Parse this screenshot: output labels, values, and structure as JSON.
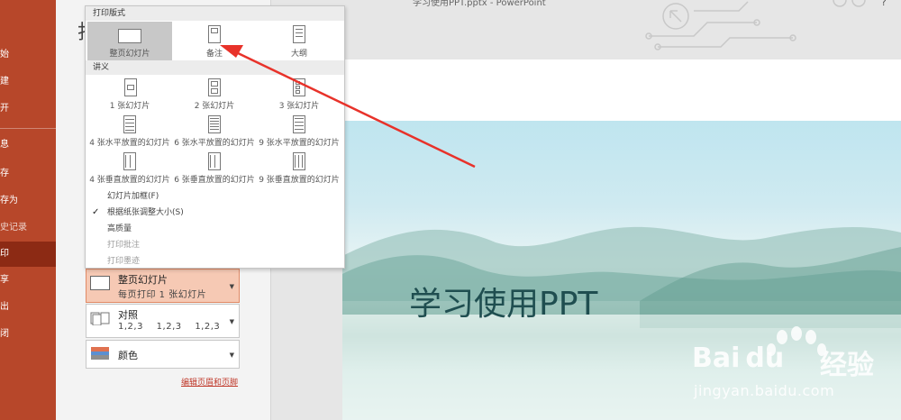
{
  "window": {
    "title": "学习使用PPT.pptx - PowerPoint"
  },
  "nav": {
    "items": [
      {
        "label": "始"
      },
      {
        "label": "建"
      },
      {
        "label": "开"
      },
      {
        "label": "息"
      },
      {
        "label": "存"
      },
      {
        "label": "存为"
      },
      {
        "label": "史记录"
      },
      {
        "label": "印",
        "active": true
      },
      {
        "label": "享"
      },
      {
        "label": "出"
      },
      {
        "label": "闭"
      }
    ]
  },
  "page": {
    "title_glyph": "打"
  },
  "popup": {
    "section_layout": "打印版式",
    "layout_options": [
      {
        "label": "整页幻灯片",
        "selected": true
      },
      {
        "label": "备注"
      },
      {
        "label": "大纲"
      }
    ],
    "section_handouts": "讲义",
    "handout_options": [
      {
        "label": "1 张幻灯片"
      },
      {
        "label": "2 张幻灯片"
      },
      {
        "label": "3 张幻灯片"
      },
      {
        "label": "4 张水平放置的幻灯片"
      },
      {
        "label": "6 张水平放置的幻灯片"
      },
      {
        "label": "9 张水平放置的幻灯片"
      },
      {
        "label": "4 张垂直放置的幻灯片"
      },
      {
        "label": "6 张垂直放置的幻灯片"
      },
      {
        "label": "9 张垂直放置的幻灯片"
      }
    ],
    "checks": [
      {
        "label": "幻灯片加框(F)",
        "checked": false,
        "enabled": true
      },
      {
        "label": "根据纸张调整大小(S)",
        "checked": true,
        "enabled": true
      },
      {
        "label": "高质量",
        "checked": false,
        "enabled": true
      },
      {
        "label": "打印批注",
        "checked": false,
        "enabled": false
      },
      {
        "label": "打印墨迹",
        "checked": false,
        "enabled": false
      }
    ],
    "checkmark": "✓"
  },
  "settings": {
    "layout_dd": {
      "title": "整页幻灯片",
      "subtitle": "每页打印 1 张幻灯片"
    },
    "collate_dd": {
      "title": "对照",
      "subtitle": "1,2,3    1,2,3    1,2,3"
    },
    "color_dd": {
      "title": "颜色"
    },
    "edit_link": "编辑页眉和页脚"
  },
  "preview": {
    "slide_title": "学习使用PPT"
  },
  "watermark": {
    "brand": "Bai",
    "paw": "du",
    "name": "经验",
    "url": "jingyan.baidu.com"
  },
  "help": "?",
  "colors": {
    "accent": "#b7472a",
    "nav_active": "#8c2a14",
    "arrow": "#e8322a",
    "selected_bg": "#f6c9b4"
  }
}
